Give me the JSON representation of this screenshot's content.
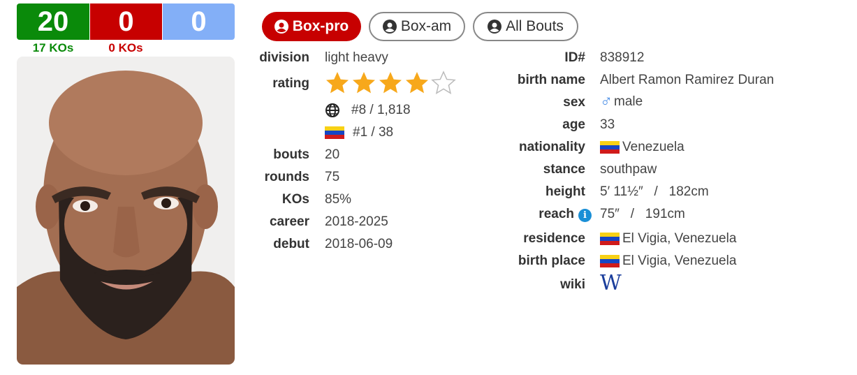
{
  "record": {
    "wins": "20",
    "losses": "0",
    "draws": "0",
    "win_kos": "17 KOs",
    "loss_kos": "0 KOs",
    "colors": {
      "win": "#0a8a0a",
      "loss": "#c70000",
      "draw": "#83aff7"
    }
  },
  "tabs": [
    {
      "label": "Box-pro",
      "active": true
    },
    {
      "label": "Box-am",
      "active": false
    },
    {
      "label": "All Bouts",
      "active": false
    }
  ],
  "left_info": {
    "division_label": "division",
    "division": "light heavy",
    "rating_label": "rating",
    "rating_stars": 4,
    "rating_max": 5,
    "world_rank": "#8 / 1,818",
    "country_rank": "#1 / 38",
    "bouts_label": "bouts",
    "bouts": "20",
    "rounds_label": "rounds",
    "rounds": "75",
    "kos_label": "KOs",
    "kos": "85%",
    "career_label": "career",
    "career": "2018-2025",
    "debut_label": "debut",
    "debut": "2018-06-09"
  },
  "right_info": {
    "id_label": "ID#",
    "id": "838912",
    "birth_name_label": "birth name",
    "birth_name": "Albert Ramon Ramirez Duran",
    "sex_label": "sex",
    "sex": "male",
    "age_label": "age",
    "age": "33",
    "nationality_label": "nationality",
    "nationality": "Venezuela",
    "stance_label": "stance",
    "stance": "southpaw",
    "height_label": "height",
    "height": "5′ 11½″   /   182cm",
    "reach_label": "reach",
    "reach": "75″   /   191cm",
    "residence_label": "residence",
    "residence": "El Vigia, Venezuela",
    "birth_place_label": "birth place",
    "birth_place": "El Vigia, Venezuela",
    "wiki_label": "wiki",
    "wiki_glyph": "W"
  },
  "icons": {
    "tab": "user-circle-icon",
    "world": "globe-icon",
    "flag": "venezuela-flag-icon",
    "sex": "male-symbol-icon",
    "reach_info": "info-icon",
    "wiki": "wikipedia-icon"
  }
}
